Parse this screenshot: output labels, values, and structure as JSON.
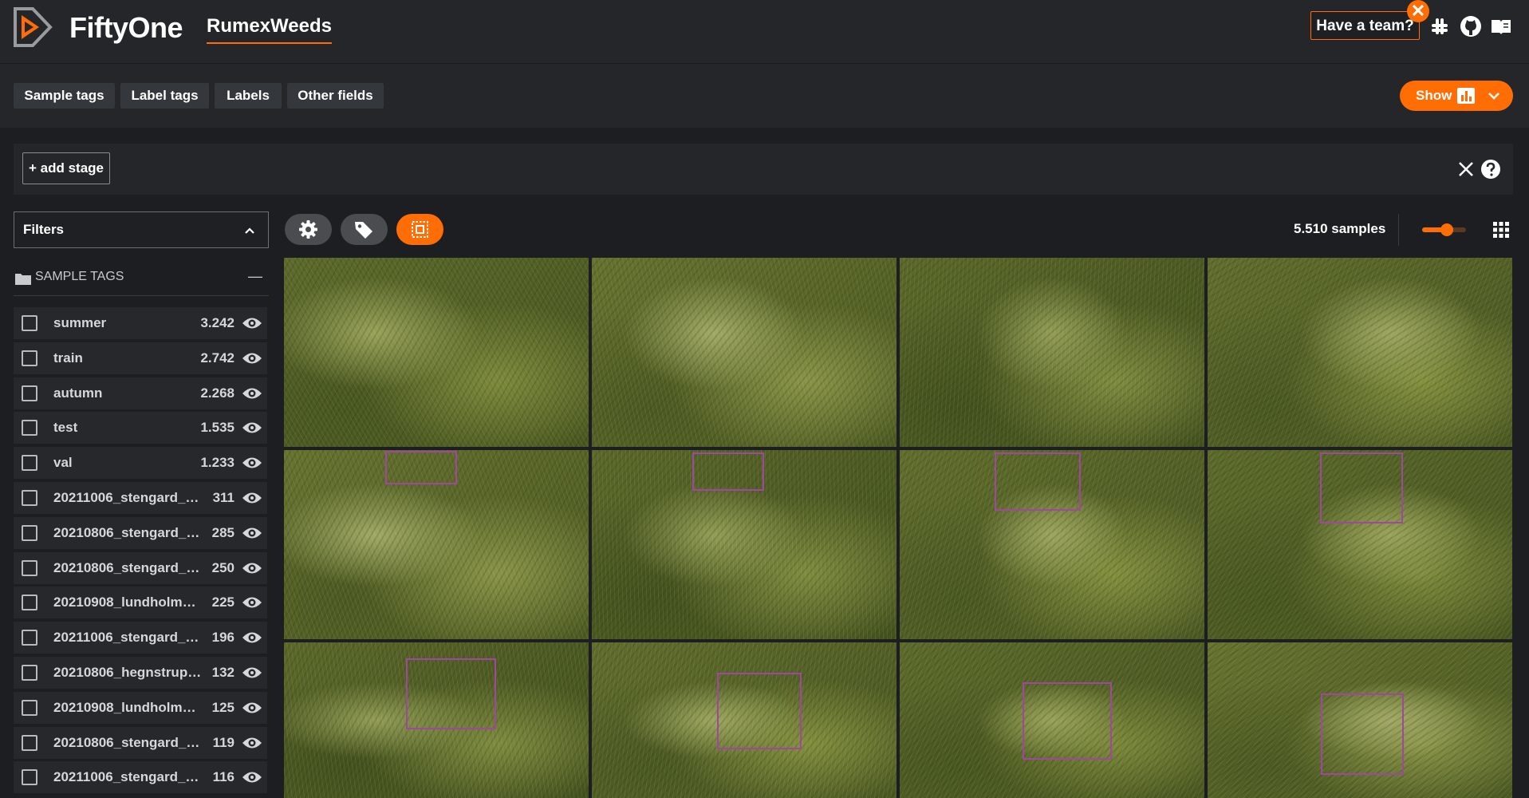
{
  "header": {
    "brand": "FiftyOne",
    "dataset": "RumexWeeds",
    "team_button": "Have a team?",
    "close_symbol": "✕"
  },
  "tabs": [
    "Sample tags",
    "Label tags",
    "Labels",
    "Other fields"
  ],
  "show_button": "Show",
  "view_bar": {
    "add_stage": "+ add stage"
  },
  "sidebar": {
    "filters_label": "Filters",
    "section_title": "SAMPLE TAGS",
    "section_toggle": "—",
    "tags": [
      {
        "name": "summer",
        "count": "3.242"
      },
      {
        "name": "train",
        "count": "2.742"
      },
      {
        "name": "autumn",
        "count": "2.268"
      },
      {
        "name": "test",
        "count": "1.535"
      },
      {
        "name": "val",
        "count": "1.233"
      },
      {
        "name": "20211006_stengard_…",
        "count": "311"
      },
      {
        "name": "20210806_stengard_…",
        "count": "285"
      },
      {
        "name": "20210806_stengard_…",
        "count": "250"
      },
      {
        "name": "20210908_lundholm…",
        "count": "225"
      },
      {
        "name": "20211006_stengard_…",
        "count": "196"
      },
      {
        "name": "20210806_hegnstrup…",
        "count": "132"
      },
      {
        "name": "20210908_lundholm…",
        "count": "125"
      },
      {
        "name": "20210806_stengard_…",
        "count": "119"
      },
      {
        "name": "20211006_stengard_…",
        "count": "116"
      }
    ]
  },
  "toolbar": {
    "sample_count": "5.510 samples",
    "zoom_level": 0.6
  },
  "colors": {
    "accent": "#ff6d04",
    "bbox": "#a0479f",
    "background": "#1c1e21",
    "panel": "#24262a"
  },
  "grid": {
    "rows": 3,
    "cols": 4
  }
}
